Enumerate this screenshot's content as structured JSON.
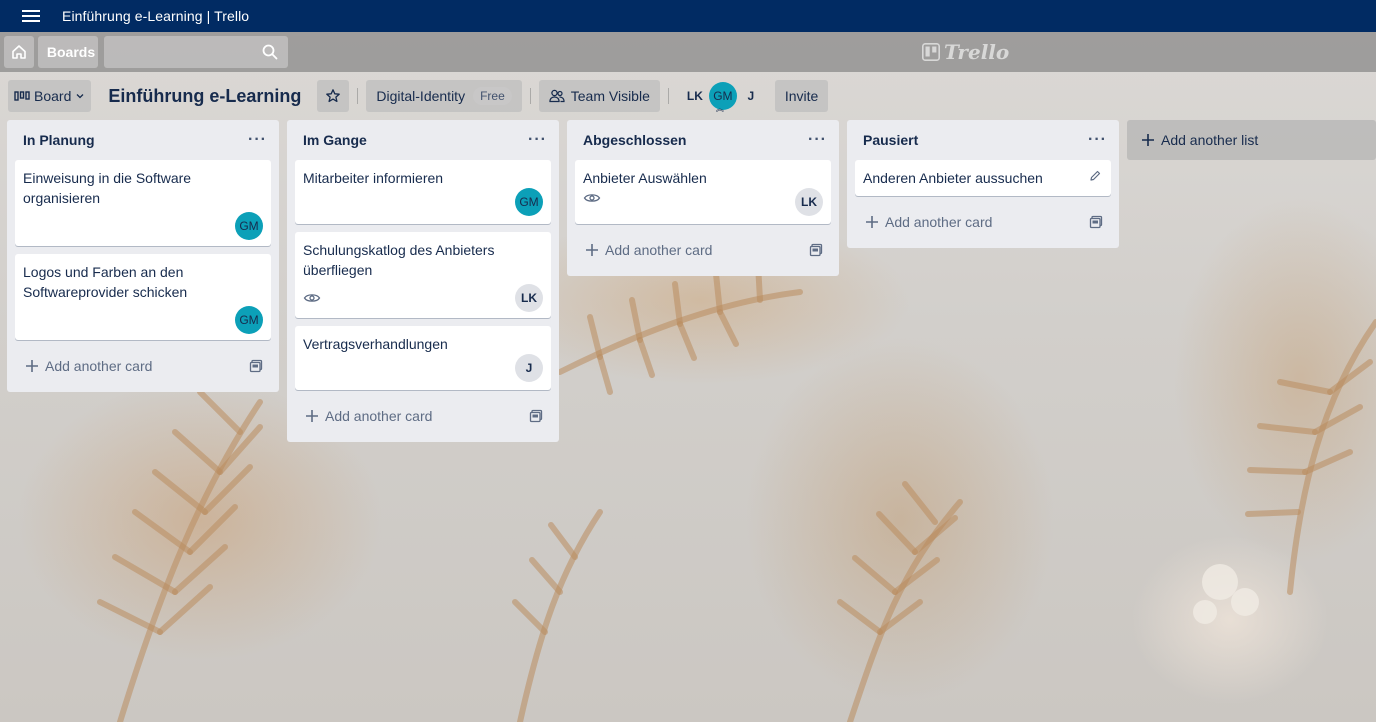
{
  "window": {
    "title": "Einführung e-Learning | Trello"
  },
  "header": {
    "boards_label": "Boards",
    "search_value": "",
    "logo_text": "Trello"
  },
  "boardbar": {
    "view_label": "Board",
    "board_title": "Einführung e-Learning",
    "workspace_label": "Digital-Identity",
    "workspace_badge": "Free",
    "visibility_label": "Team Visible",
    "members": [
      "LK",
      "GM",
      "J"
    ],
    "invite_label": "Invite"
  },
  "lists": [
    {
      "title": "In Planung",
      "cards": [
        {
          "title": "Einweisung in die Software organisieren",
          "member": "GM"
        },
        {
          "title": "Logos und Farben an den Softwareprovider schicken",
          "member": "GM"
        }
      ],
      "add_card_label": "Add another card"
    },
    {
      "title": "Im Gange",
      "cards": [
        {
          "title": "Mitarbeiter informieren",
          "member": "GM"
        },
        {
          "title": "Schulungskatlog des Anbieters überfliegen",
          "member": "LK"
        },
        {
          "title": "Vertragsverhandlungen",
          "member": "J"
        }
      ],
      "add_card_label": "Add another card"
    },
    {
      "title": "Abgeschlossen",
      "cards": [
        {
          "title": "Anbieter Auswählen",
          "member": "LK"
        }
      ],
      "add_card_label": "Add another card"
    },
    {
      "title": "Pausiert",
      "cards": [
        {
          "title": "Anderen Anbieter aussuchen"
        }
      ],
      "add_card_label": "Add another card"
    }
  ],
  "add_list_label": "Add another list",
  "colors": {
    "titlebar": "#012b63",
    "list_bg": "#ebecf0",
    "avatar_gm": "#0ca0b8",
    "avatar_default": "#dfe1e6"
  }
}
